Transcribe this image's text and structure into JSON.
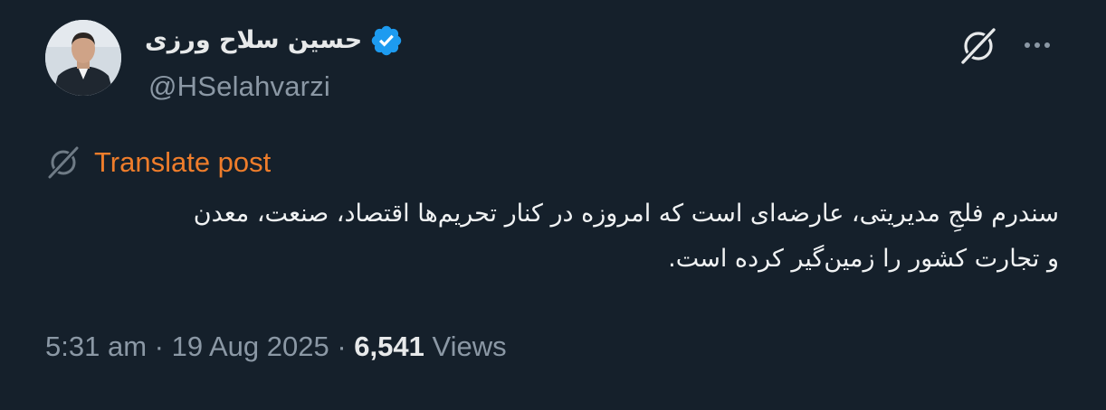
{
  "author": {
    "display_name": "حسین سلاح ورزی",
    "handle": "@HSelahvarzi",
    "verified": true
  },
  "icons": {
    "verified": "verified-badge-icon",
    "grok": "grok-icon",
    "more": "more-dots-icon",
    "translate": "grok-translate-icon"
  },
  "translate": {
    "label": "Translate post"
  },
  "post": {
    "text_lines": [
      "سندرم فلجِ مدیریتی، عارضه‌ای است که امروزه در کنار تحریم‌ها اقتصاد، صنعت، معدن",
      "و تجارت کشور را زمین‌گیر کرده است."
    ]
  },
  "meta": {
    "time": "5:31 am",
    "separator": "·",
    "date": "19 Aug 2025",
    "views_count": "6,541",
    "views_label": "Views"
  },
  "colors": {
    "background": "#15202b",
    "accent_orange": "#ef7d2b",
    "verified_blue": "#1d9bf0",
    "secondary_text": "#8b98a5"
  }
}
